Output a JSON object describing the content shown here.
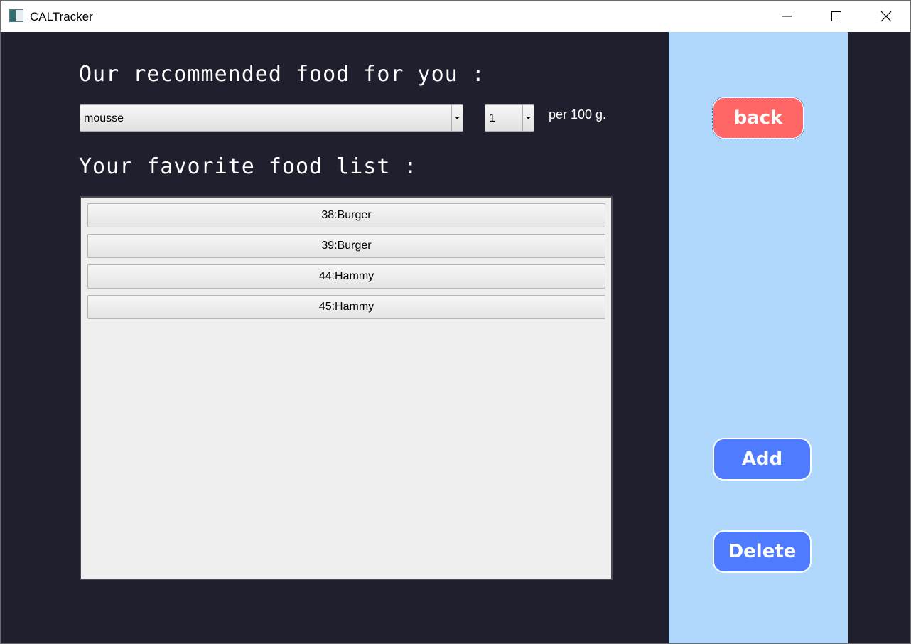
{
  "window": {
    "title": "CALTracker"
  },
  "main": {
    "recommended_heading": "Our recommended food for you :",
    "food_select": {
      "value": "mousse"
    },
    "quantity_select": {
      "value": "1"
    },
    "per_label": "per 100 g.",
    "favorites_heading": "Your favorite food list :",
    "favorites": [
      {
        "label": "38:Burger"
      },
      {
        "label": "39:Burger"
      },
      {
        "label": "44:Hammy"
      },
      {
        "label": "45:Hammy"
      }
    ]
  },
  "side": {
    "back_label": "back",
    "add_label": "Add",
    "delete_label": "Delete"
  },
  "colors": {
    "background": "#1f1f2e",
    "side_panel": "#b0d7fc",
    "back_button": "#ff6666",
    "action_button": "#4f7cff"
  }
}
